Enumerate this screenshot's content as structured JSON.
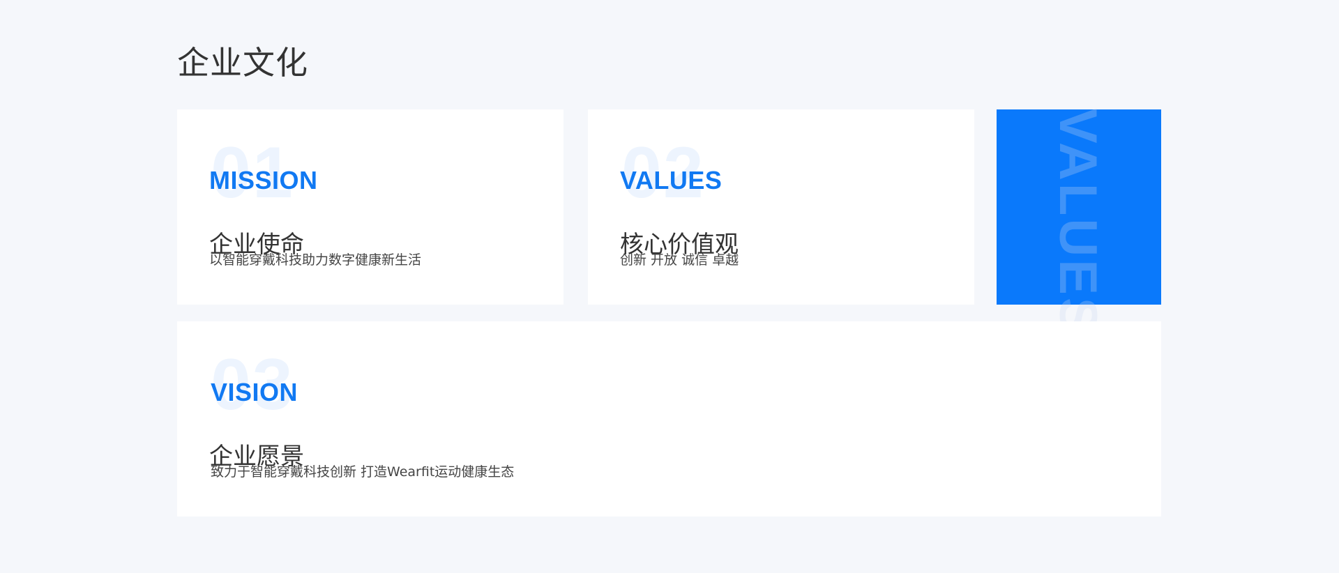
{
  "page": {
    "title": "企业文化"
  },
  "cards": {
    "mission": {
      "number": "01",
      "english": "MISSION",
      "title": "企业使命",
      "description": "以智能穿戴科技助力数字健康新生活"
    },
    "values": {
      "number": "02",
      "english": "VALUES",
      "title": "核心价值观",
      "description": "创新 开放 诚信 卓越"
    },
    "vision": {
      "number": "03",
      "english": "VISION",
      "title": "企业愿景",
      "description": "致力于智能穿戴科技创新 打造Wearfit运动健康生态"
    }
  },
  "accent": {
    "watermark": "VALUES",
    "color": "#0a79fb"
  },
  "colors": {
    "background": "#f5f7fb",
    "card": "#ffffff",
    "brand_blue": "#1179f2",
    "number_watermark": "#edf4fe",
    "text_primary": "#333333"
  }
}
